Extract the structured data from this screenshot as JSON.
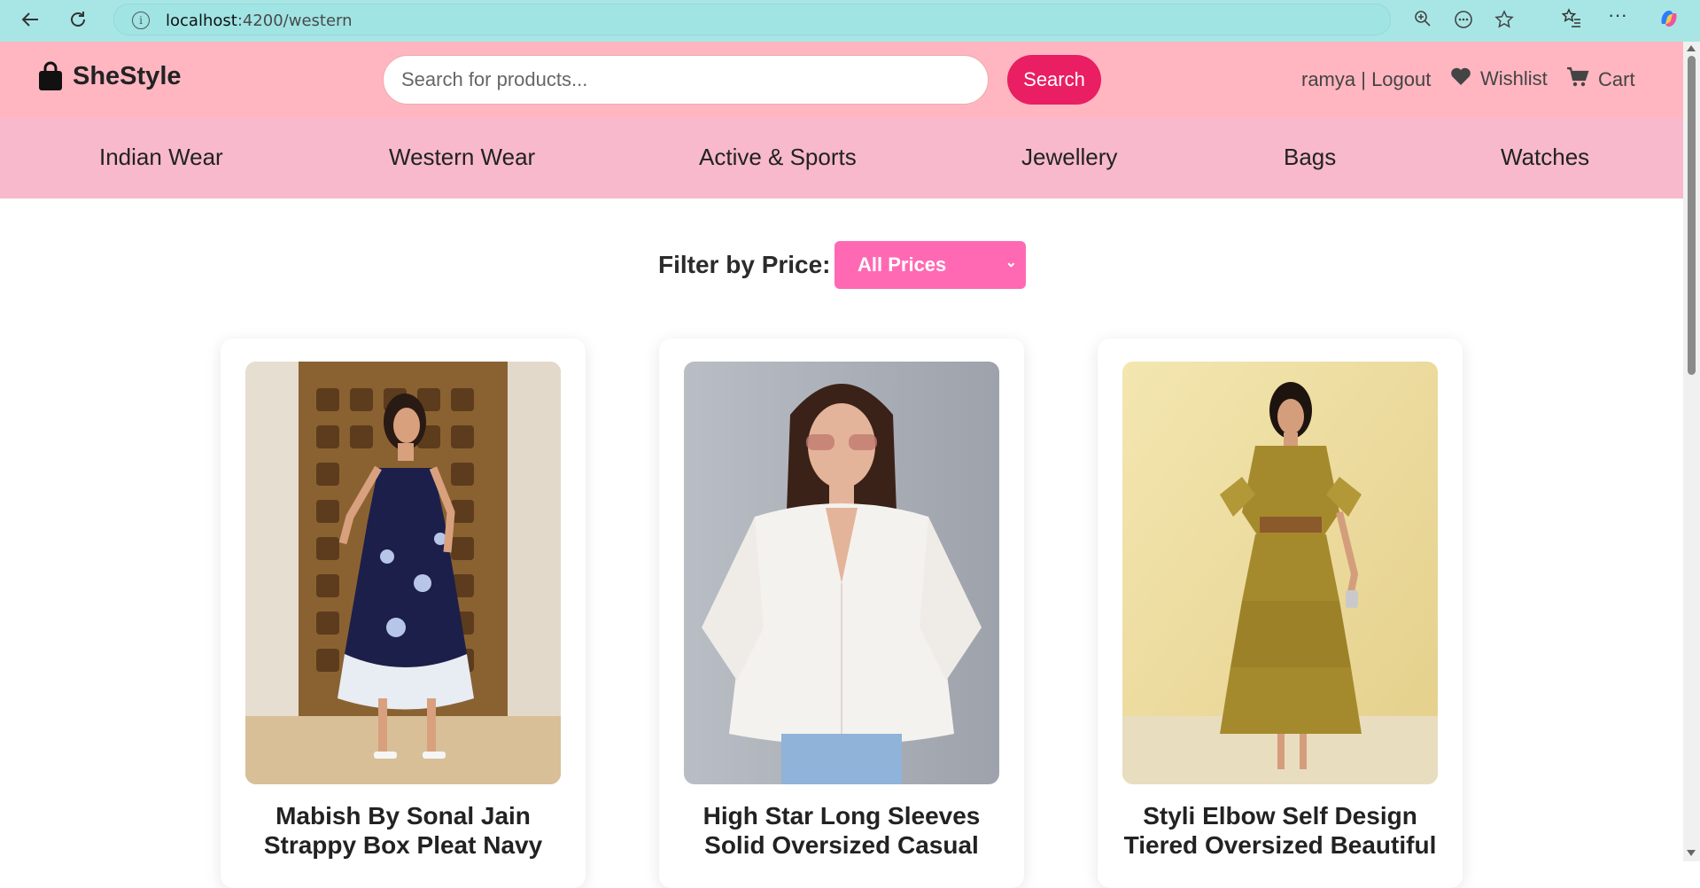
{
  "browser": {
    "url_host": "localhost",
    "url_path": ":4200/western"
  },
  "header": {
    "logo_text": "SheStyle",
    "search_placeholder": "Search for products...",
    "search_button": "Search",
    "user_links": "ramya | Logout",
    "wishlist_label": "Wishlist",
    "cart_label": "Cart"
  },
  "categories": [
    "Indian Wear",
    "Western Wear",
    "Active & Sports",
    "Jewellery",
    "Bags",
    "Watches"
  ],
  "filter": {
    "label": "Filter by Price:",
    "selected": "All Prices"
  },
  "products": [
    {
      "title_line1": "Mabish By Sonal Jain",
      "title_line2": "Strappy Box Pleat Navy"
    },
    {
      "title_line1": "High Star Long Sleeves",
      "title_line2": "Solid Oversized Casual"
    },
    {
      "title_line1": "Styli Elbow Self Design",
      "title_line2": "Tiered Oversized Beautiful"
    }
  ],
  "colors": {
    "header_bg": "#ffb6c1",
    "nav_bg": "#f8b9cc",
    "accent": "#e91e63",
    "filter_bg": "#ff69b4",
    "browser_bar": "#a8e6e6"
  }
}
